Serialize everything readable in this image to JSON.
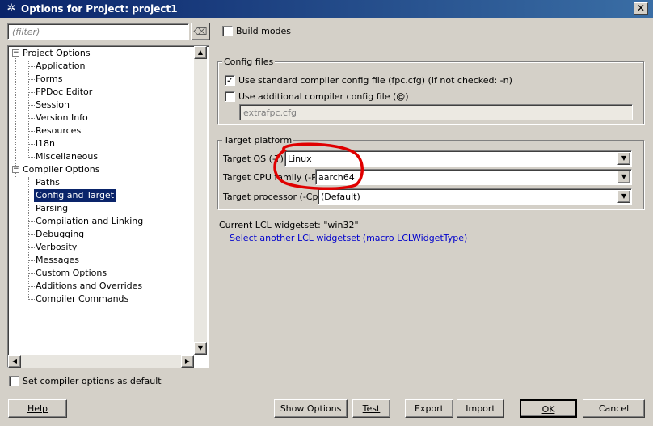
{
  "window": {
    "title": "Options for Project: project1",
    "close_glyph": "✕"
  },
  "filter": {
    "placeholder": "(filter)"
  },
  "tree": {
    "groups": [
      {
        "label": "Project Options",
        "expander": "−",
        "children": [
          "Application",
          "Forms",
          "FPDoc Editor",
          "Session",
          "Version Info",
          "Resources",
          "i18n",
          "Miscellaneous"
        ]
      },
      {
        "label": "Compiler Options",
        "expander": "−",
        "children": [
          "Paths",
          "Config and Target",
          "Parsing",
          "Compilation and Linking",
          "Debugging",
          "Verbosity",
          "Messages",
          "Custom Options",
          "Additions and Overrides",
          "Compiler Commands"
        ]
      }
    ],
    "selected": "Config and Target"
  },
  "build_modes": {
    "label": "Build modes",
    "checked": false
  },
  "config_files": {
    "title": "Config files",
    "use_standard": {
      "label": "Use standard compiler config file (fpc.cfg) (If not checked: -n)",
      "checked": true
    },
    "use_additional": {
      "label": "Use additional compiler config file (@)",
      "checked": false
    },
    "additional_value": "extrafpc.cfg"
  },
  "target_platform": {
    "title": "Target platform",
    "os_label": "Target OS (-T)",
    "os_value": "Linux",
    "cpu_label": "Target CPU family (-P)",
    "cpu_value": "aarch64",
    "processor_label": "Target processor (-Cp)",
    "processor_value": "(Default)"
  },
  "lcl": {
    "current": "Current LCL widgetset: \"win32\"",
    "select_link": "Select another LCL widgetset (macro LCLWidgetType)"
  },
  "set_default": {
    "label": "Set compiler options as default",
    "checked": false
  },
  "buttons": {
    "help": "Help",
    "show_options": "Show Options",
    "test": "Test",
    "export": "Export",
    "import": "Import",
    "ok": "OK",
    "cancel": "Cancel"
  },
  "annotation_color": "#e00000"
}
